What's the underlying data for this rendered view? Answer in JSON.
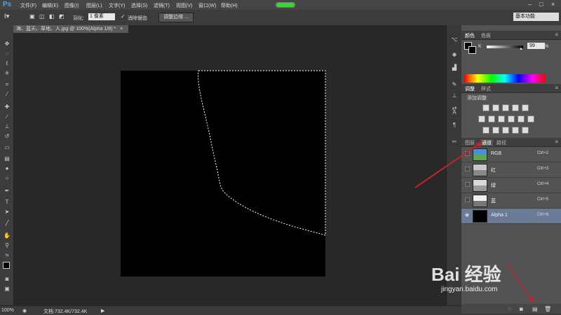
{
  "app": {
    "logo": "Ps"
  },
  "menu": [
    "文件(F)",
    "编辑(E)",
    "图像(I)",
    "图层(L)",
    "文字(Y)",
    "选择(S)",
    "滤镜(T)",
    "视图(V)",
    "窗口(W)",
    "帮助(H)"
  ],
  "window_controls": {
    "minimize": "–",
    "maximize": "□",
    "close": "×"
  },
  "options": {
    "feather_label": "羽化:",
    "feather_value": "1 像素",
    "antialias_label": "消除锯齿",
    "antialias_checked": true,
    "refine_edge": "调整边缘 ...",
    "workspace": "基本功能"
  },
  "document": {
    "tab_title": "海、蓝天、草地、人.jpg @ 100%(Alpha 1/8) *",
    "tab_close": "×"
  },
  "status": {
    "zoom": "100%",
    "doc_info": "文档:732.4K/732.4K",
    "arrow": "▶"
  },
  "color_panel": {
    "tabs": [
      "颜色",
      "色板"
    ],
    "channel_label": "K",
    "value": "99",
    "unit": "%"
  },
  "adjustments_panel": {
    "tabs": [
      "调整",
      "样式"
    ],
    "title": "添加调整"
  },
  "layers_panel": {
    "tabs": [
      "图层",
      "通道",
      "路径"
    ],
    "active_tab": "通道",
    "channels": [
      {
        "name": "RGB",
        "shortcut": "Ctrl+2",
        "visible": false
      },
      {
        "name": "红",
        "shortcut": "Ctrl+3",
        "visible": false
      },
      {
        "name": "绿",
        "shortcut": "Ctrl+4",
        "visible": false
      },
      {
        "name": "蓝",
        "shortcut": "Ctrl+5",
        "visible": false
      },
      {
        "name": "Alpha 1",
        "shortcut": "Ctrl+6",
        "visible": true,
        "selected": true
      }
    ]
  },
  "watermark": {
    "logo": "Bai 经验",
    "url": "jingyan.baidu.com"
  },
  "colors": {
    "accent_arrow": "#c0252b",
    "selected_row": "#6b7a95",
    "ps_blue": "#4ea4e4"
  }
}
